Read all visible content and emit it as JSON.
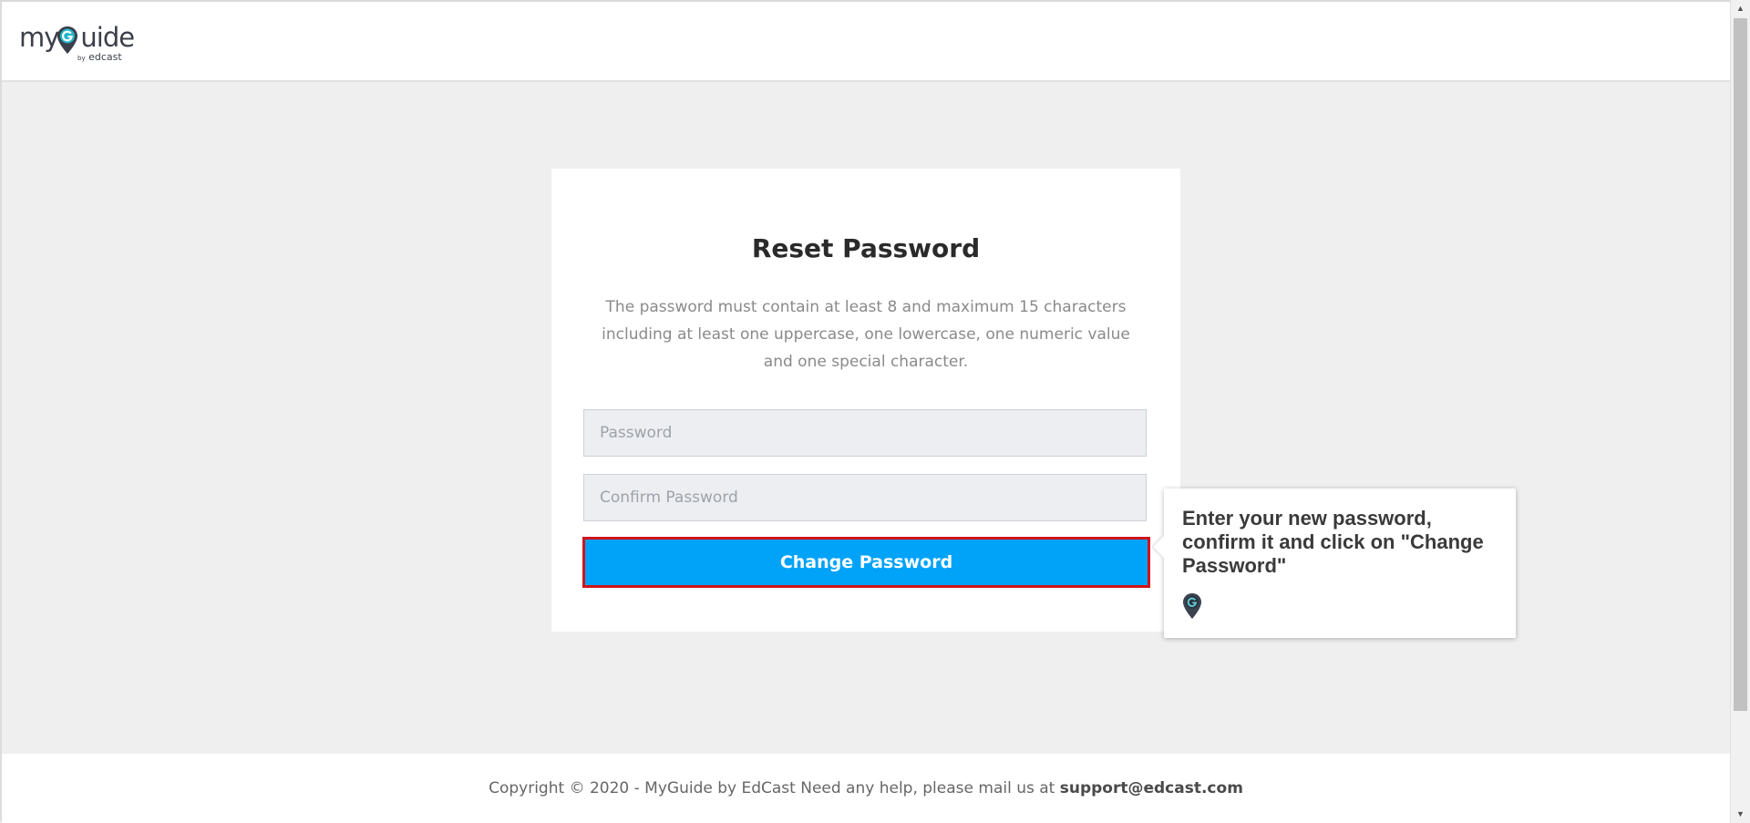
{
  "header": {
    "logo_text_left": "my",
    "logo_text_right": "uide",
    "logo_by": "by",
    "logo_sub": "edcast"
  },
  "card": {
    "title": "Reset Password",
    "description": "The password must contain at least 8 and maximum 15 characters including at least one uppercase, one lowercase, one numeric value and one special character.",
    "password_placeholder": "Password",
    "password_value": "",
    "confirm_placeholder": "Confirm Password",
    "confirm_value": "",
    "submit_label": "Change Password"
  },
  "tooltip": {
    "text": "Enter your new password, confirm it and click on \"Change Password\"",
    "icon": "myguide-pin-icon"
  },
  "footer": {
    "text": "Copyright © 2020 - MyGuide by EdCast Need any help, please mail us at ",
    "email": "support@edcast.com"
  },
  "colors": {
    "primary_button": "#00a3f7",
    "highlight_border": "#d0141c",
    "page_background": "#efefef",
    "field_background": "#eceef2"
  }
}
